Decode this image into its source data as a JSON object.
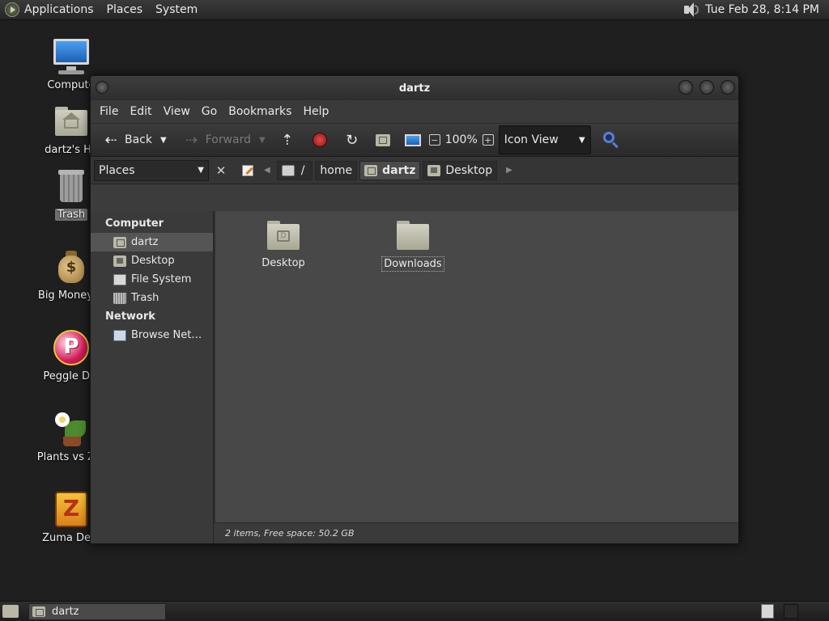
{
  "top_panel": {
    "menus": [
      "Applications",
      "Places",
      "System"
    ],
    "clock": "Tue Feb 28,  8:14 PM"
  },
  "desktop_icons": [
    {
      "label": "Compute",
      "icon": "computer-icon"
    },
    {
      "label": "dartz's Ho",
      "icon": "home-folder-icon"
    },
    {
      "label": "Trash",
      "icon": "trash-icon",
      "selected": true
    },
    {
      "label": "Big Money D",
      "icon": "money-bag-icon"
    },
    {
      "label": "Peggle Del",
      "icon": "peggle-icon"
    },
    {
      "label": "Plants vs Zor",
      "icon": "plants-icon"
    },
    {
      "label": "Zuma Delu",
      "icon": "zuma-icon"
    }
  ],
  "window": {
    "title": "dartz",
    "menu": [
      "File",
      "Edit",
      "View",
      "Go",
      "Bookmarks",
      "Help"
    ],
    "toolbar": {
      "back_label": "Back",
      "forward_label": "Forward",
      "zoom_level": "100%",
      "view_mode": "Icon View"
    },
    "location": {
      "sidebar_selector": "Places",
      "root_separator": "/",
      "crumbs": [
        "home",
        "dartz",
        "Desktop"
      ],
      "active_crumb": "dartz"
    },
    "sidebar": {
      "sections": [
        {
          "heading": "Computer",
          "items": [
            {
              "label": "dartz",
              "icon": "home-icon",
              "selected": true
            },
            {
              "label": "Desktop",
              "icon": "desktop-icon"
            },
            {
              "label": "File System",
              "icon": "filesystem-icon"
            },
            {
              "label": "Trash",
              "icon": "trash-icon"
            }
          ]
        },
        {
          "heading": "Network",
          "items": [
            {
              "label": "Browse Net…",
              "icon": "network-icon"
            }
          ]
        }
      ]
    },
    "files": [
      {
        "name": "Desktop",
        "icon": "desktop-folder-icon"
      },
      {
        "name": "Downloads",
        "icon": "folder-icon",
        "focused": true
      }
    ],
    "status": "2 items, Free space: 50.2 GB"
  },
  "taskbar": {
    "tasks": [
      {
        "label": "dartz"
      }
    ]
  }
}
